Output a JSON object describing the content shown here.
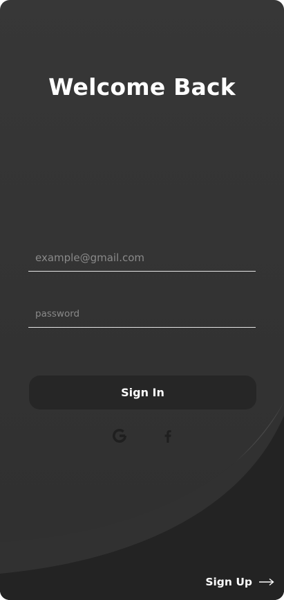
{
  "screen": {
    "title": "Welcome Back"
  },
  "form": {
    "email_placeholder": "example@gmail.com",
    "email_value": "",
    "password_placeholder": "password",
    "password_value": "",
    "signin_label": "Sign In"
  },
  "social": {
    "providers": [
      {
        "name": "google",
        "icon": "google-icon"
      },
      {
        "name": "facebook",
        "icon": "facebook-icon"
      }
    ]
  },
  "footer": {
    "signup_label": "Sign Up",
    "signup_icon": "arrow-right-icon"
  },
  "colors": {
    "background_top": "#373737",
    "background_bottom": "#2f2f2f",
    "wave_dark": "#232323",
    "wave_light": "#474747",
    "button": "#262626",
    "text": "#ffffff",
    "placeholder": "#8a8a8a",
    "social_icon": "#1f1f1f"
  }
}
